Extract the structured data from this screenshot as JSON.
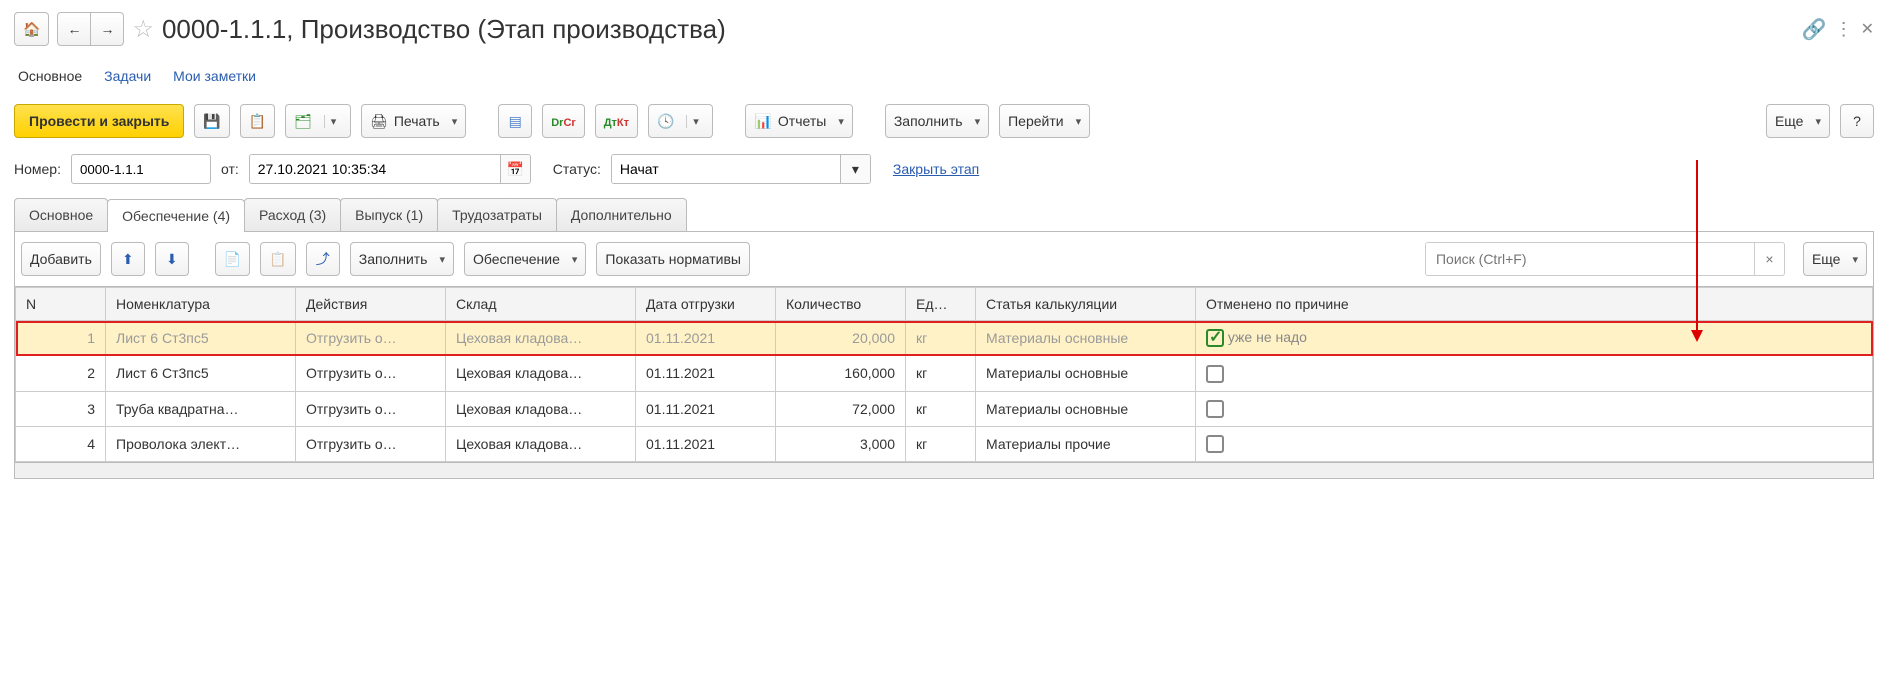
{
  "title": "0000-1.1.1, Производство (Этап производства)",
  "nav": {
    "main": "Основное",
    "tasks": "Задачи",
    "notes": "Мои заметки"
  },
  "actions": {
    "post_close": "Провести и закрыть",
    "print": "Печать",
    "reports": "Отчеты",
    "fill": "Заполнить",
    "goto": "Перейти",
    "more": "Еще",
    "help": "?"
  },
  "fields": {
    "number_label": "Номер:",
    "number_value": "0000-1.1.1",
    "from_label": "от:",
    "date_value": "27.10.2021 10:35:34",
    "status_label": "Статус:",
    "status_value": "Начат",
    "close_stage": "Закрыть этап"
  },
  "tabs": {
    "main": "Основное",
    "supply": "Обеспечение (4)",
    "expense": "Расход (3)",
    "output": "Выпуск (1)",
    "labor": "Трудозатраты",
    "additional": "Дополнительно"
  },
  "subtoolbar": {
    "add": "Добавить",
    "fill": "Заполнить",
    "supply": "Обеспечение",
    "show_norms": "Показать нормативы",
    "search_placeholder": "Поиск (Ctrl+F)",
    "more": "Еще"
  },
  "table": {
    "headers": {
      "n": "N",
      "nomenclature": "Номенклатура",
      "actions": "Действия",
      "warehouse": "Склад",
      "ship_date": "Дата отгрузки",
      "qty": "Количество",
      "unit": "Ед…",
      "article": "Статья калькуляции",
      "cancelled": "Отменено по причине"
    },
    "rows": [
      {
        "n": "1",
        "nom": "Лист 6 Ст3пс5",
        "act": "Отгрузить о…",
        "wh": "Цеховая кладова…",
        "date": "01.11.2021",
        "qty": "20,000",
        "unit": "кг",
        "art": "Материалы основные",
        "cancelled": true,
        "reason": "уже не надо",
        "highlighted": true
      },
      {
        "n": "2",
        "nom": "Лист 6 Ст3пс5",
        "act": "Отгрузить о…",
        "wh": "Цеховая кладова…",
        "date": "01.11.2021",
        "qty": "160,000",
        "unit": "кг",
        "art": "Материалы основные",
        "cancelled": false,
        "reason": ""
      },
      {
        "n": "3",
        "nom": "Труба квадратна…",
        "act": "Отгрузить о…",
        "wh": "Цеховая кладова…",
        "date": "01.11.2021",
        "qty": "72,000",
        "unit": "кг",
        "art": "Материалы основные",
        "cancelled": false,
        "reason": ""
      },
      {
        "n": "4",
        "nom": "Проволока элект…",
        "act": "Отгрузить о…",
        "wh": "Цеховая кладова…",
        "date": "01.11.2021",
        "qty": "3,000",
        "unit": "кг",
        "art": "Материалы прочие",
        "cancelled": false,
        "reason": ""
      }
    ]
  }
}
